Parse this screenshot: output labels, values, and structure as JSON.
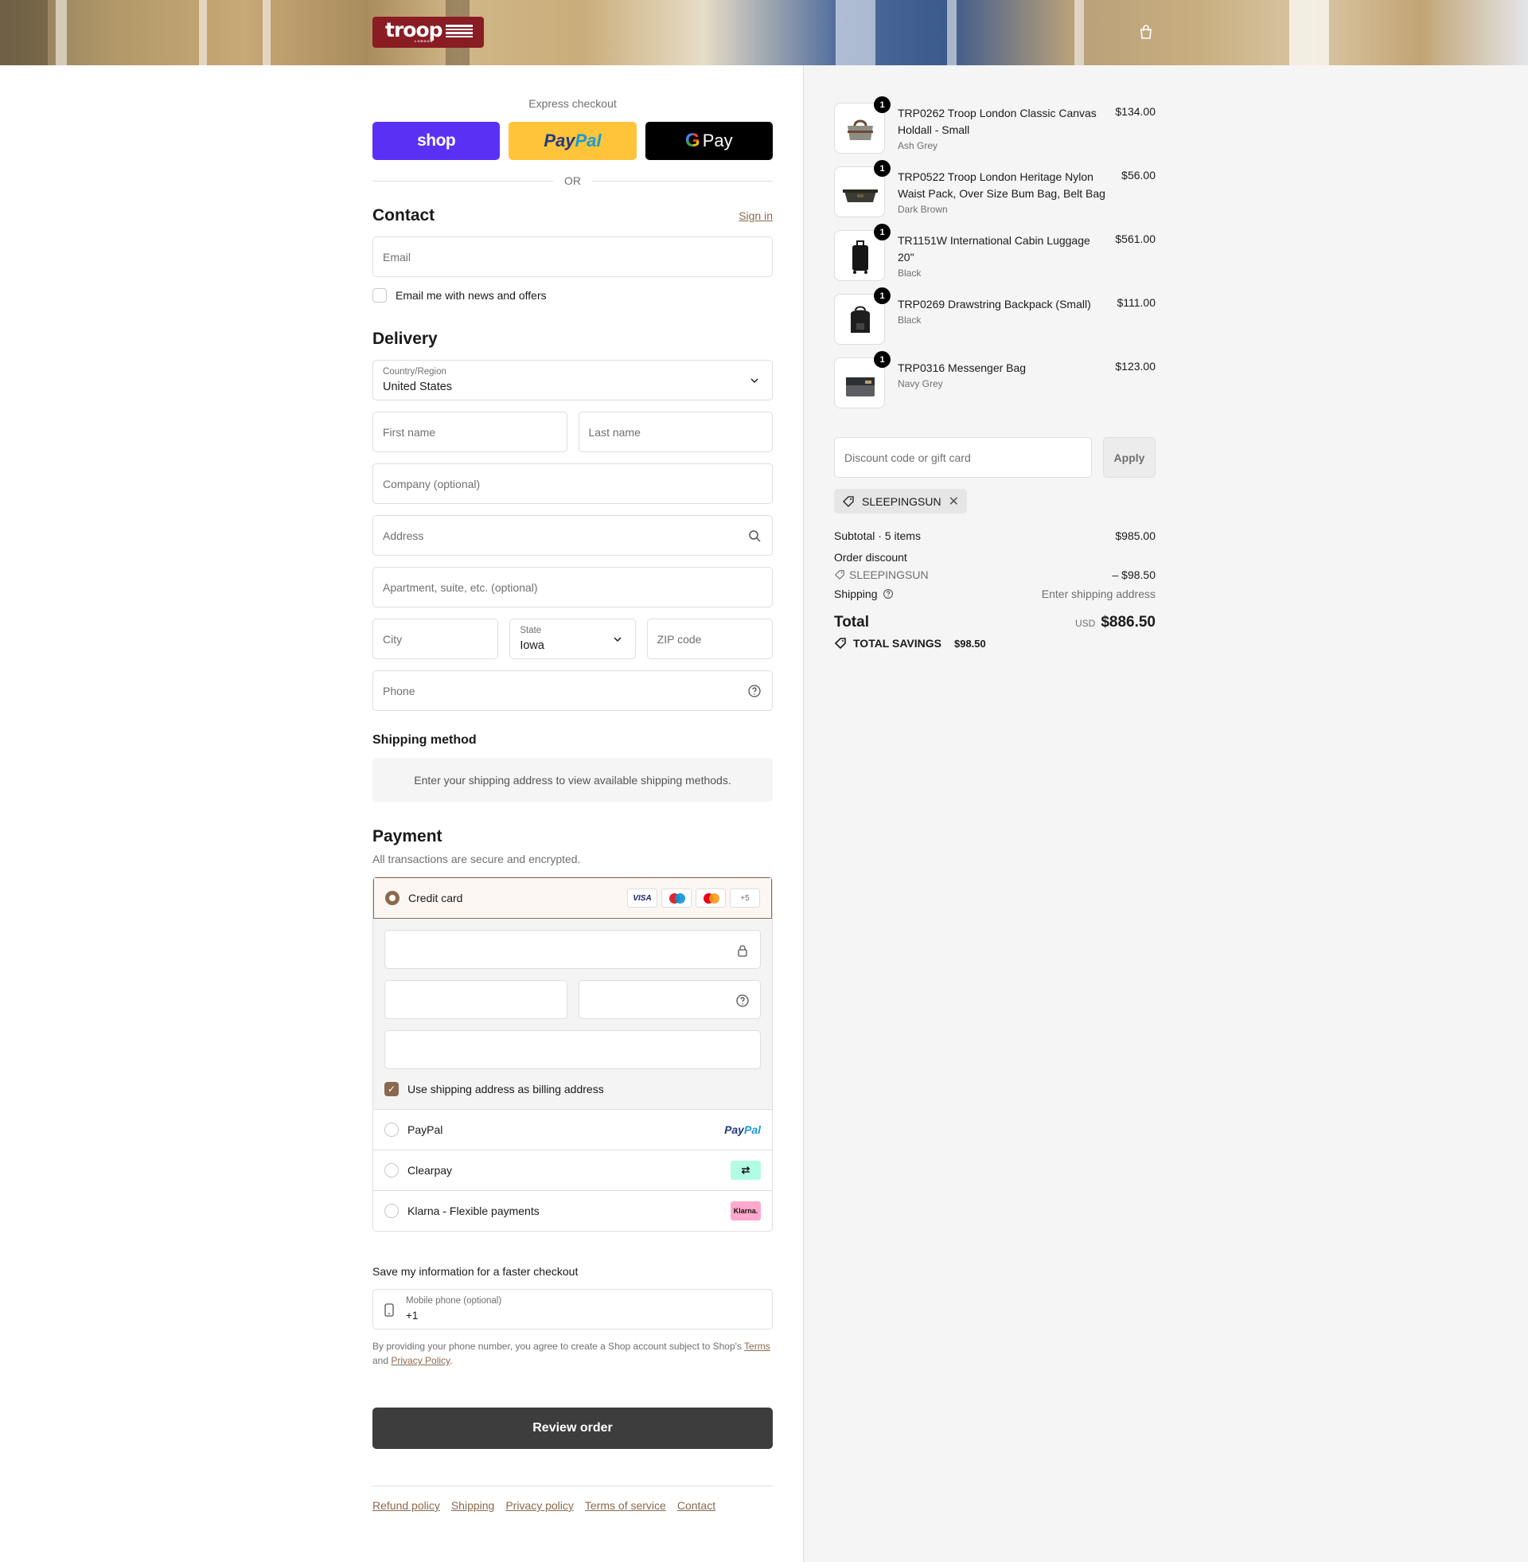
{
  "brand": {
    "logo_word": "troop",
    "logo_sub": "LONDON"
  },
  "express": {
    "title": "Express checkout",
    "shop_label": "shop",
    "paypal_a": "Pay",
    "paypal_b": "Pal",
    "gpay_g": "G",
    "gpay_label": "Pay",
    "or": "OR"
  },
  "contact": {
    "title": "Contact",
    "sign_in": "Sign in",
    "email_placeholder": "Email",
    "news_label": "Email me with news and offers"
  },
  "delivery": {
    "title": "Delivery",
    "country_label": "Country/Region",
    "country_value": "United States",
    "first_name": "First name",
    "last_name": "Last name",
    "company": "Company (optional)",
    "address": "Address",
    "apartment": "Apartment, suite, etc. (optional)",
    "city": "City",
    "state_label": "State",
    "state_value": "Iowa",
    "zip": "ZIP code",
    "phone": "Phone"
  },
  "shipping": {
    "title": "Shipping method",
    "message": "Enter your shipping address to view available shipping methods."
  },
  "payment": {
    "title": "Payment",
    "subtitle": "All transactions are secure and encrypted.",
    "credit_card": "Credit card",
    "card_brands": {
      "visa": "VISA",
      "more": "+5"
    },
    "billing_label": "Use shipping address as billing address",
    "paypal": "PayPal",
    "paypal_logo_a": "Pay",
    "paypal_logo_b": "Pal",
    "clearpay": "Clearpay",
    "klarna": "Klarna - Flexible payments",
    "klarna_logo": "Klarna."
  },
  "save": {
    "title": "Save my information for a faster checkout",
    "mobile_label": "Mobile phone (optional)",
    "mobile_value": "+1",
    "terms_a": "By providing your phone number, you agree to create a Shop account subject to Shop's ",
    "terms_link": "Terms",
    "terms_b": " and ",
    "privacy_link": "Privacy Policy",
    "terms_c": "."
  },
  "review_button": "Review order",
  "footer": {
    "links": [
      "Refund policy",
      "Shipping",
      "Privacy policy",
      "Terms of service",
      "Contact"
    ]
  },
  "cart": {
    "items": [
      {
        "qty": "1",
        "name": "TRP0262 Troop London Classic Canvas Holdall - Small",
        "variant": "Ash Grey",
        "price": "$134.00",
        "color": "#8d8d85"
      },
      {
        "qty": "1",
        "name": "TRP0522 Troop London Heritage Nylon Waist Pack, Over Size Bum Bag, Belt Bag",
        "variant": "Dark Brown",
        "price": "$56.00",
        "color": "#3b3a33"
      },
      {
        "qty": "1",
        "name": "TR1151W International Cabin Luggage 20\"",
        "variant": "Black",
        "price": "$561.00",
        "color": "#151515"
      },
      {
        "qty": "1",
        "name": "TRP0269 Drawstring Backpack (Small)",
        "variant": "Black",
        "price": "$111.00",
        "color": "#1e1e1e"
      },
      {
        "qty": "1",
        "name": "TRP0316 Messenger Bag",
        "variant": "Navy Grey",
        "price": "$123.00",
        "color": "#5c5e62"
      }
    ],
    "discount_placeholder": "Discount code or gift card",
    "apply": "Apply",
    "applied_code": "SLEEPINGSUN",
    "subtotal_label": "Subtotal · 5 items",
    "subtotal_value": "$985.00",
    "order_discount_label": "Order discount",
    "discount_code": "SLEEPINGSUN",
    "discount_value": "– $98.50",
    "shipping_label": "Shipping",
    "shipping_value": "Enter shipping address",
    "total_label": "Total",
    "currency": "USD",
    "total_value": "$886.50",
    "savings_label": "TOTAL SAVINGS",
    "savings_value": "$98.50"
  },
  "colors": {
    "accent": "#8a6a4e",
    "shop": "#5a31f4",
    "paypal": "#ffc439",
    "brand": "#8a1c23"
  }
}
